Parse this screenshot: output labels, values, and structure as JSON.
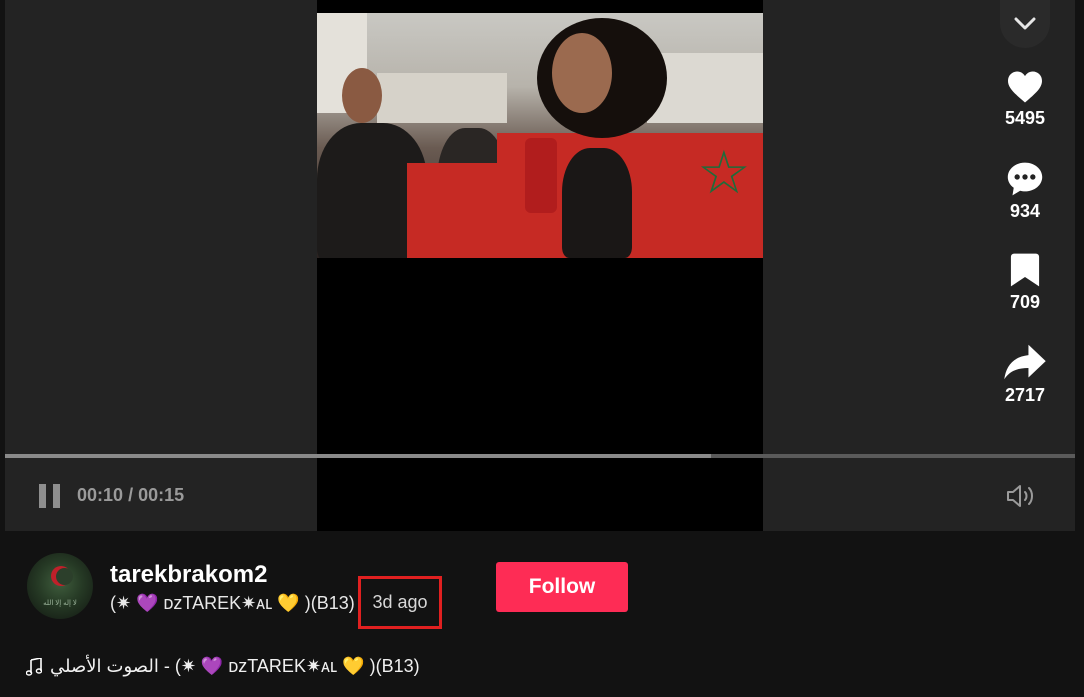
{
  "player": {
    "time_current": "00:10",
    "time_separator": "/",
    "time_total": "00:15",
    "progress_fraction": 0.66,
    "is_playing": true
  },
  "actions": {
    "likes": "5495",
    "comments": "934",
    "bookmarks": "709",
    "shares": "2717"
  },
  "author": {
    "username": "tarekbrakom2",
    "nickname": "(✷ 💜 ᴅᴢTAREK✷ᴀʟ 💛 )(B13)",
    "posted": "3d ago",
    "avatar_caption": "لا إله إلا الله"
  },
  "follow_label": "Follow",
  "music": {
    "text": "الصوت الأصلي - (✷ 💜 ᴅᴢTAREK✷ᴀʟ 💛 )(B13)",
    "icon": "music-note-icon"
  },
  "colors": {
    "accent": "#fe2c55",
    "highlight_box": "#e02020"
  }
}
